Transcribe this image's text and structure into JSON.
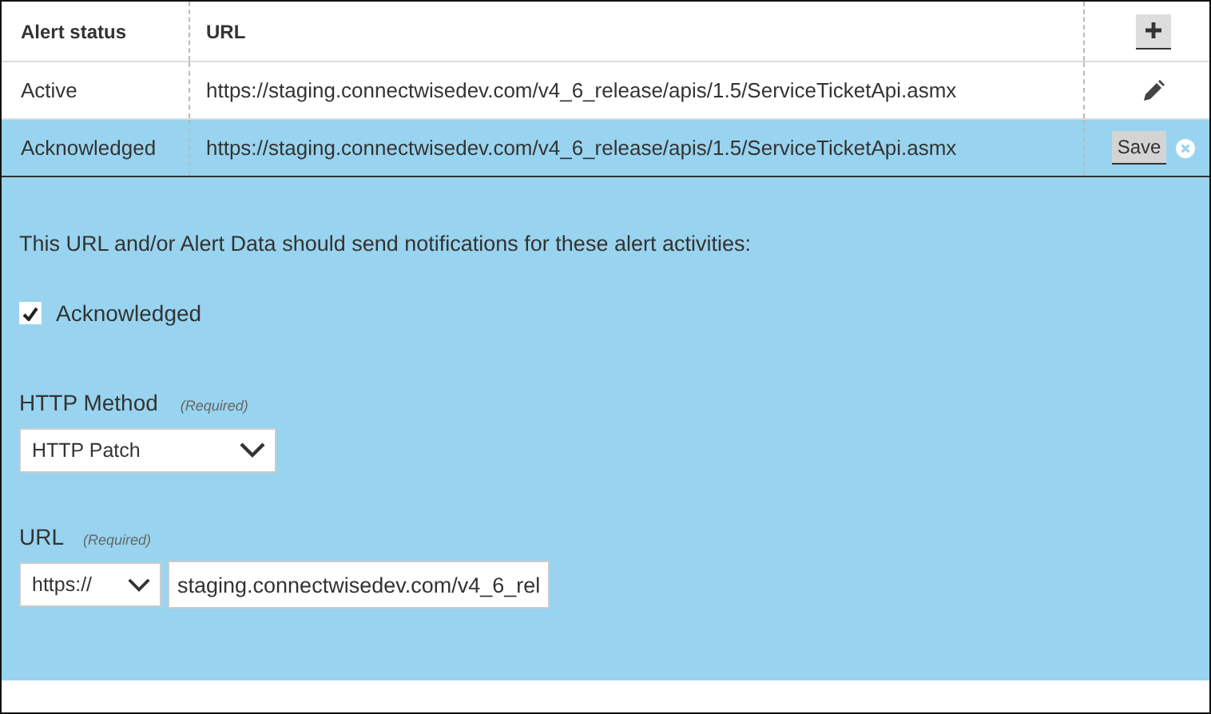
{
  "table": {
    "columns": [
      "Alert status",
      "URL"
    ],
    "rows": [
      {
        "status": "Active",
        "url": "https://staging.connectwisedev.com/v4_6_release/apis/1.5/ServiceTicketApi.asmx",
        "selected": false,
        "kind": "view"
      },
      {
        "status": "Acknowledged",
        "url": "https://staging.connectwisedev.com/v4_6_release/apis/1.5/ServiceTicketApi.asmx",
        "selected": true,
        "kind": "edit",
        "save_label": "Save"
      }
    ]
  },
  "editor": {
    "intro": "This URL and/or Alert Data should send notifications for these alert activities:",
    "activities": [
      {
        "label": "Acknowledged",
        "checked": true
      }
    ],
    "method": {
      "label": "HTTP Method",
      "note": "(Required)",
      "value": "HTTP Patch"
    },
    "url": {
      "label": "URL",
      "note": "(Required)",
      "scheme": "https://",
      "value": "staging.connectwisedev.com/v4_6_rel"
    }
  }
}
